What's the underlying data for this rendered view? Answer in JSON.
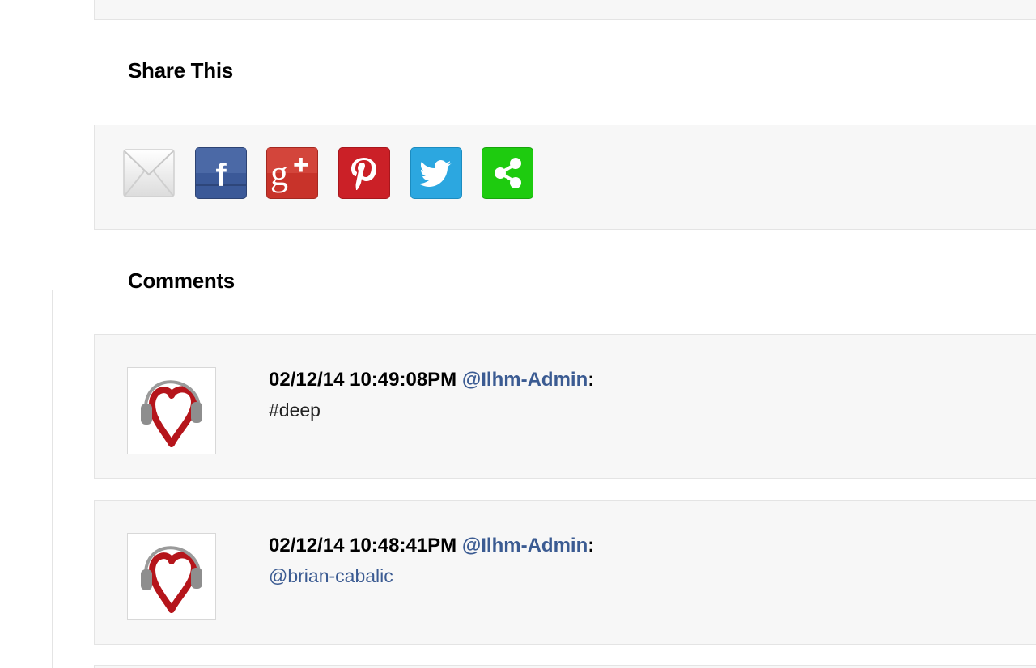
{
  "share": {
    "title": "Share This",
    "icons": [
      {
        "name": "email-icon",
        "color": "#f2f2f2"
      },
      {
        "name": "facebook-icon",
        "color": "#3b5998"
      },
      {
        "name": "google-plus-icon",
        "color": "#c8332a"
      },
      {
        "name": "pinterest-icon",
        "color": "#cb2027"
      },
      {
        "name": "twitter-icon",
        "color": "#2ca7e0"
      },
      {
        "name": "share-icon",
        "color": "#1ecb0f"
      }
    ]
  },
  "comments": {
    "title": "Comments",
    "items": [
      {
        "timestamp": "02/12/14 10:49:08PM",
        "author": "@Ilhm-Admin",
        "separator": ":",
        "body": "#deep"
      },
      {
        "timestamp": "02/12/14 10:48:41PM",
        "author": "@Ilhm-Admin",
        "separator": ":",
        "body": "@brian-cabalic"
      }
    ]
  },
  "colors": {
    "link": "#3b5b92",
    "panel_bg": "#f7f7f7",
    "border": "#e4e4e4"
  }
}
